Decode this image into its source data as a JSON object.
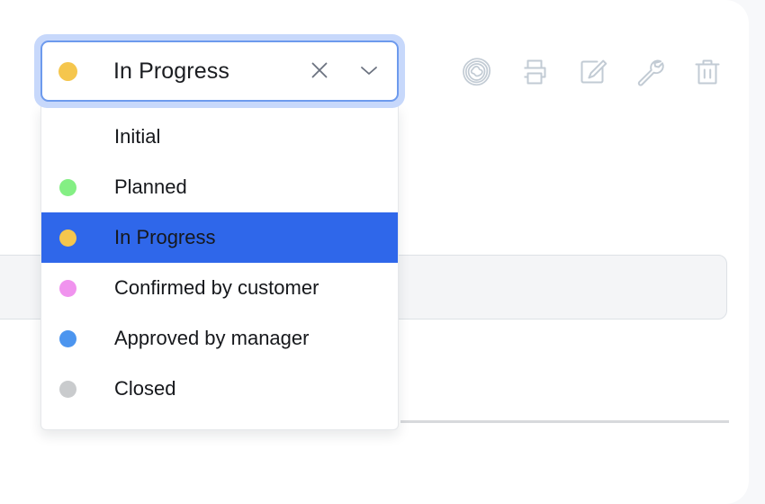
{
  "select": {
    "value_label": "In Progress",
    "value_color": "#f5c64d",
    "clear_icon": "close-icon",
    "expand_icon": "chevron-down-icon"
  },
  "dropdown": {
    "options": [
      {
        "label": "Initial",
        "color": "",
        "selected": false
      },
      {
        "label": "Planned",
        "color": "#84ef84",
        "selected": false
      },
      {
        "label": "In Progress",
        "color": "#f5c64d",
        "selected": true
      },
      {
        "label": "Confirmed by customer",
        "color": "#f093ee",
        "selected": false
      },
      {
        "label": "Approved by manager",
        "color": "#4c95ef",
        "selected": false
      },
      {
        "label": "Closed",
        "color": "#c9cbcd",
        "selected": false
      }
    ],
    "highlight_color": "#2f67ea"
  },
  "toolbar": {
    "icon_color": "#c2cbd4",
    "buttons": [
      {
        "name": "contour-map-icon",
        "label": "Map"
      },
      {
        "name": "print-icon",
        "label": "Print"
      },
      {
        "name": "edit-icon",
        "label": "Edit"
      },
      {
        "name": "wrench-icon",
        "label": "Settings"
      },
      {
        "name": "trash-icon",
        "label": "Delete"
      }
    ]
  }
}
